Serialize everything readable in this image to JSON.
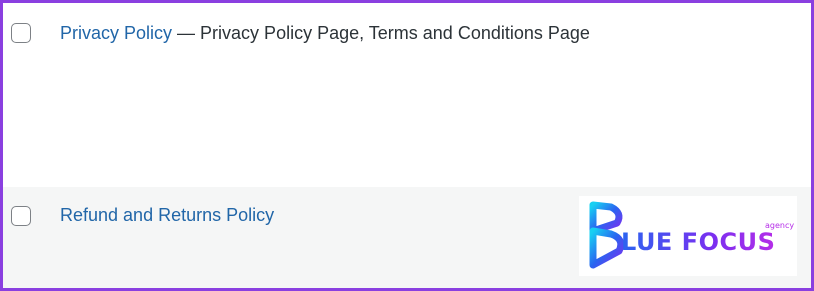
{
  "rows": [
    {
      "title": "Privacy Policy",
      "separator": " — ",
      "states": "Privacy Policy Page, Terms and Conditions Page"
    },
    {
      "title": "Refund and Returns Policy"
    }
  ],
  "logo": {
    "text": "LUE FOCUS",
    "subtext": "agency",
    "icon": "blue-focus-b-mark",
    "colors": {
      "start": "#2a64f0",
      "mid": "#7b2ff0",
      "end": "#b52de8",
      "cyan": "#17d0f2"
    }
  },
  "colors": {
    "frame_border": "#8a3fe0",
    "link": "#2166a8",
    "text": "#2c3338",
    "alt_row_bg": "#f5f6f6"
  }
}
